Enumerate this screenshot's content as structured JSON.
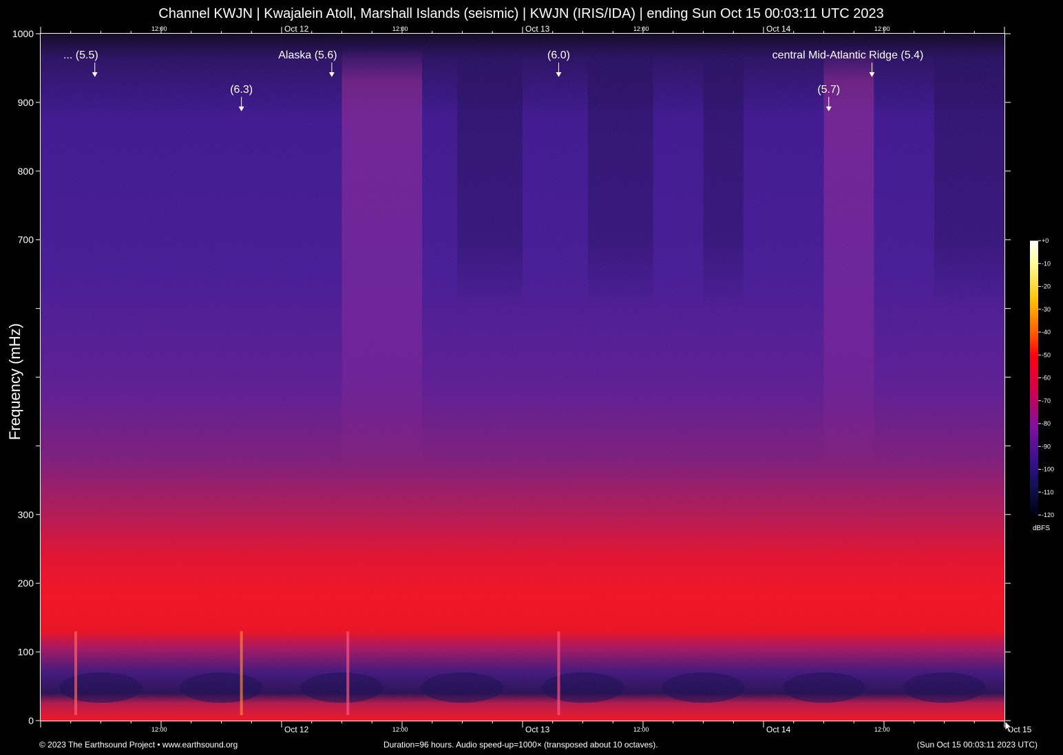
{
  "header": {
    "title": "Channel KWJN | Kwajalein Atoll, Marshall Islands (seismic) | KWJN (IRIS/IDA) | ending Sun Oct 15 00:03:11 UTC 2023"
  },
  "footer": {
    "copyright": "© 2023 The Earthsound Project • www.earthsound.org",
    "duration_note": "Duration=96 hours. Audio speed-up=1000× (transposed about 10 octaves).",
    "end_time": "(Sun Oct 15 00:03:11 2023 UTC)"
  },
  "chart_data": {
    "type": "heatmap",
    "title": "Channel KWJN | Kwajalein Atoll, Marshall Islands (seismic) | KWJN (IRIS/IDA) | ending Sun Oct 15 00:03:11 UTC 2023",
    "ylabel": "Frequency (mHz)",
    "xlabel": "",
    "ylim": [
      0,
      1000
    ],
    "xlim_hours": [
      0,
      96
    ],
    "y_ticks": [
      {
        "value": 0,
        "label": "0"
      },
      {
        "value": 100,
        "label": "100"
      },
      {
        "value": 200,
        "label": "200"
      },
      {
        "value": 300,
        "label": "300"
      },
      {
        "value": 400,
        "label": ""
      },
      {
        "value": 500,
        "label": ""
      },
      {
        "value": 600,
        "label": ""
      },
      {
        "value": 700,
        "label": "700"
      },
      {
        "value": 800,
        "label": "800"
      },
      {
        "value": 900,
        "label": "900"
      },
      {
        "value": 1000,
        "label": "1000"
      }
    ],
    "x_major_ticks": [
      {
        "hour": 0,
        "label": ""
      },
      {
        "hour": 12,
        "label": "12:00"
      },
      {
        "hour": 24,
        "label": "Oct 12"
      },
      {
        "hour": 36,
        "label": "12:00"
      },
      {
        "hour": 48,
        "label": "Oct 13"
      },
      {
        "hour": 60,
        "label": "12:00"
      },
      {
        "hour": 72,
        "label": "Oct 14"
      },
      {
        "hour": 84,
        "label": "12:00"
      },
      {
        "hour": 96,
        "label": "Oct 15"
      }
    ],
    "colorbar": {
      "unit": "dBFS",
      "range": [
        -120,
        0
      ],
      "ticks": [
        "+0",
        "-10",
        "-20",
        "-30",
        "-40",
        "-50",
        "-60",
        "-70",
        "-80",
        "-90",
        "-100",
        "-110",
        "-120"
      ]
    },
    "annotations": [
      {
        "label": "... (5.5)",
        "hour": 4.0,
        "freq": 960
      },
      {
        "label": "Alaska (5.6)",
        "hour": 26.6,
        "freq": 960
      },
      {
        "label": "(6.3)",
        "hour": 20.0,
        "freq": 910
      },
      {
        "label": "(6.0)",
        "hour": 51.6,
        "freq": 960
      },
      {
        "label": "central Mid-Atlantic Ridge (5.4)",
        "hour": 80.4,
        "freq": 960
      },
      {
        "label": "(5.7)",
        "hour": 78.5,
        "freq": 910
      }
    ]
  }
}
